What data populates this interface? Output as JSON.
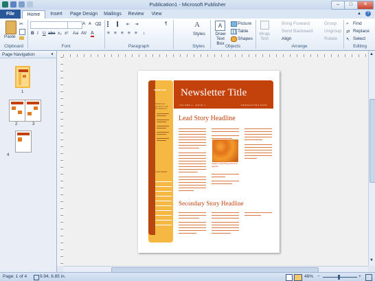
{
  "window": {
    "title": "Publication1 - Microsoft Publisher",
    "minimize": "–",
    "maximize": "□",
    "close": "✕"
  },
  "tabs": [
    "File",
    "Home",
    "Insert",
    "Page Design",
    "Mailings",
    "Review",
    "View"
  ],
  "ribbon": {
    "paste_label": "Paste",
    "groups": [
      "Clipboard",
      "Font",
      "Paragraph",
      "Styles",
      "Objects",
      "Arrange",
      "Editing"
    ],
    "font_name": "",
    "font_size": "",
    "styles_label": "Styles",
    "draw_text_box_label": "Draw Text Box",
    "picture_label": "Picture",
    "table_label": "Table",
    "shapes_label": "Shapes",
    "wrap_text_label": "Wrap Text",
    "bring_forward_label": "Bring Forward",
    "send_backward_label": "Send Backward",
    "align_label": "Align",
    "group_label": "Group",
    "ungroup_label": "Ungroup",
    "rotate_label": "Rotate",
    "find_label": "Find",
    "replace_label": "Replace",
    "select_label": "Select"
  },
  "nav_pane": {
    "title": "Page Navigation",
    "pages": [
      "1",
      "2",
      "3",
      "4"
    ]
  },
  "newsletter": {
    "title": "Newsletter Title",
    "volume_line": "VOLUME 1, ISSUE 1",
    "date_line": "NEWSLETTER DATE",
    "sidebar_title": "INSIDE THIS",
    "special_points": "SPECIAL POINTS OF INTEREST:",
    "in_this_issue": "THIS ISSUE:",
    "lead_headline": "Lead Story Headline",
    "caption": "Caption describing picture or graphic.",
    "secondary_headline": "Secondary Story Headline"
  },
  "status": {
    "page": "Page: 1 of 4",
    "position": "9.94, 6.85 in.",
    "zoom": "48%"
  },
  "colors": {
    "accent_orange": "#c3410b",
    "sidebar_yellow": "#f5b843",
    "file_tab": "#2a579a"
  }
}
